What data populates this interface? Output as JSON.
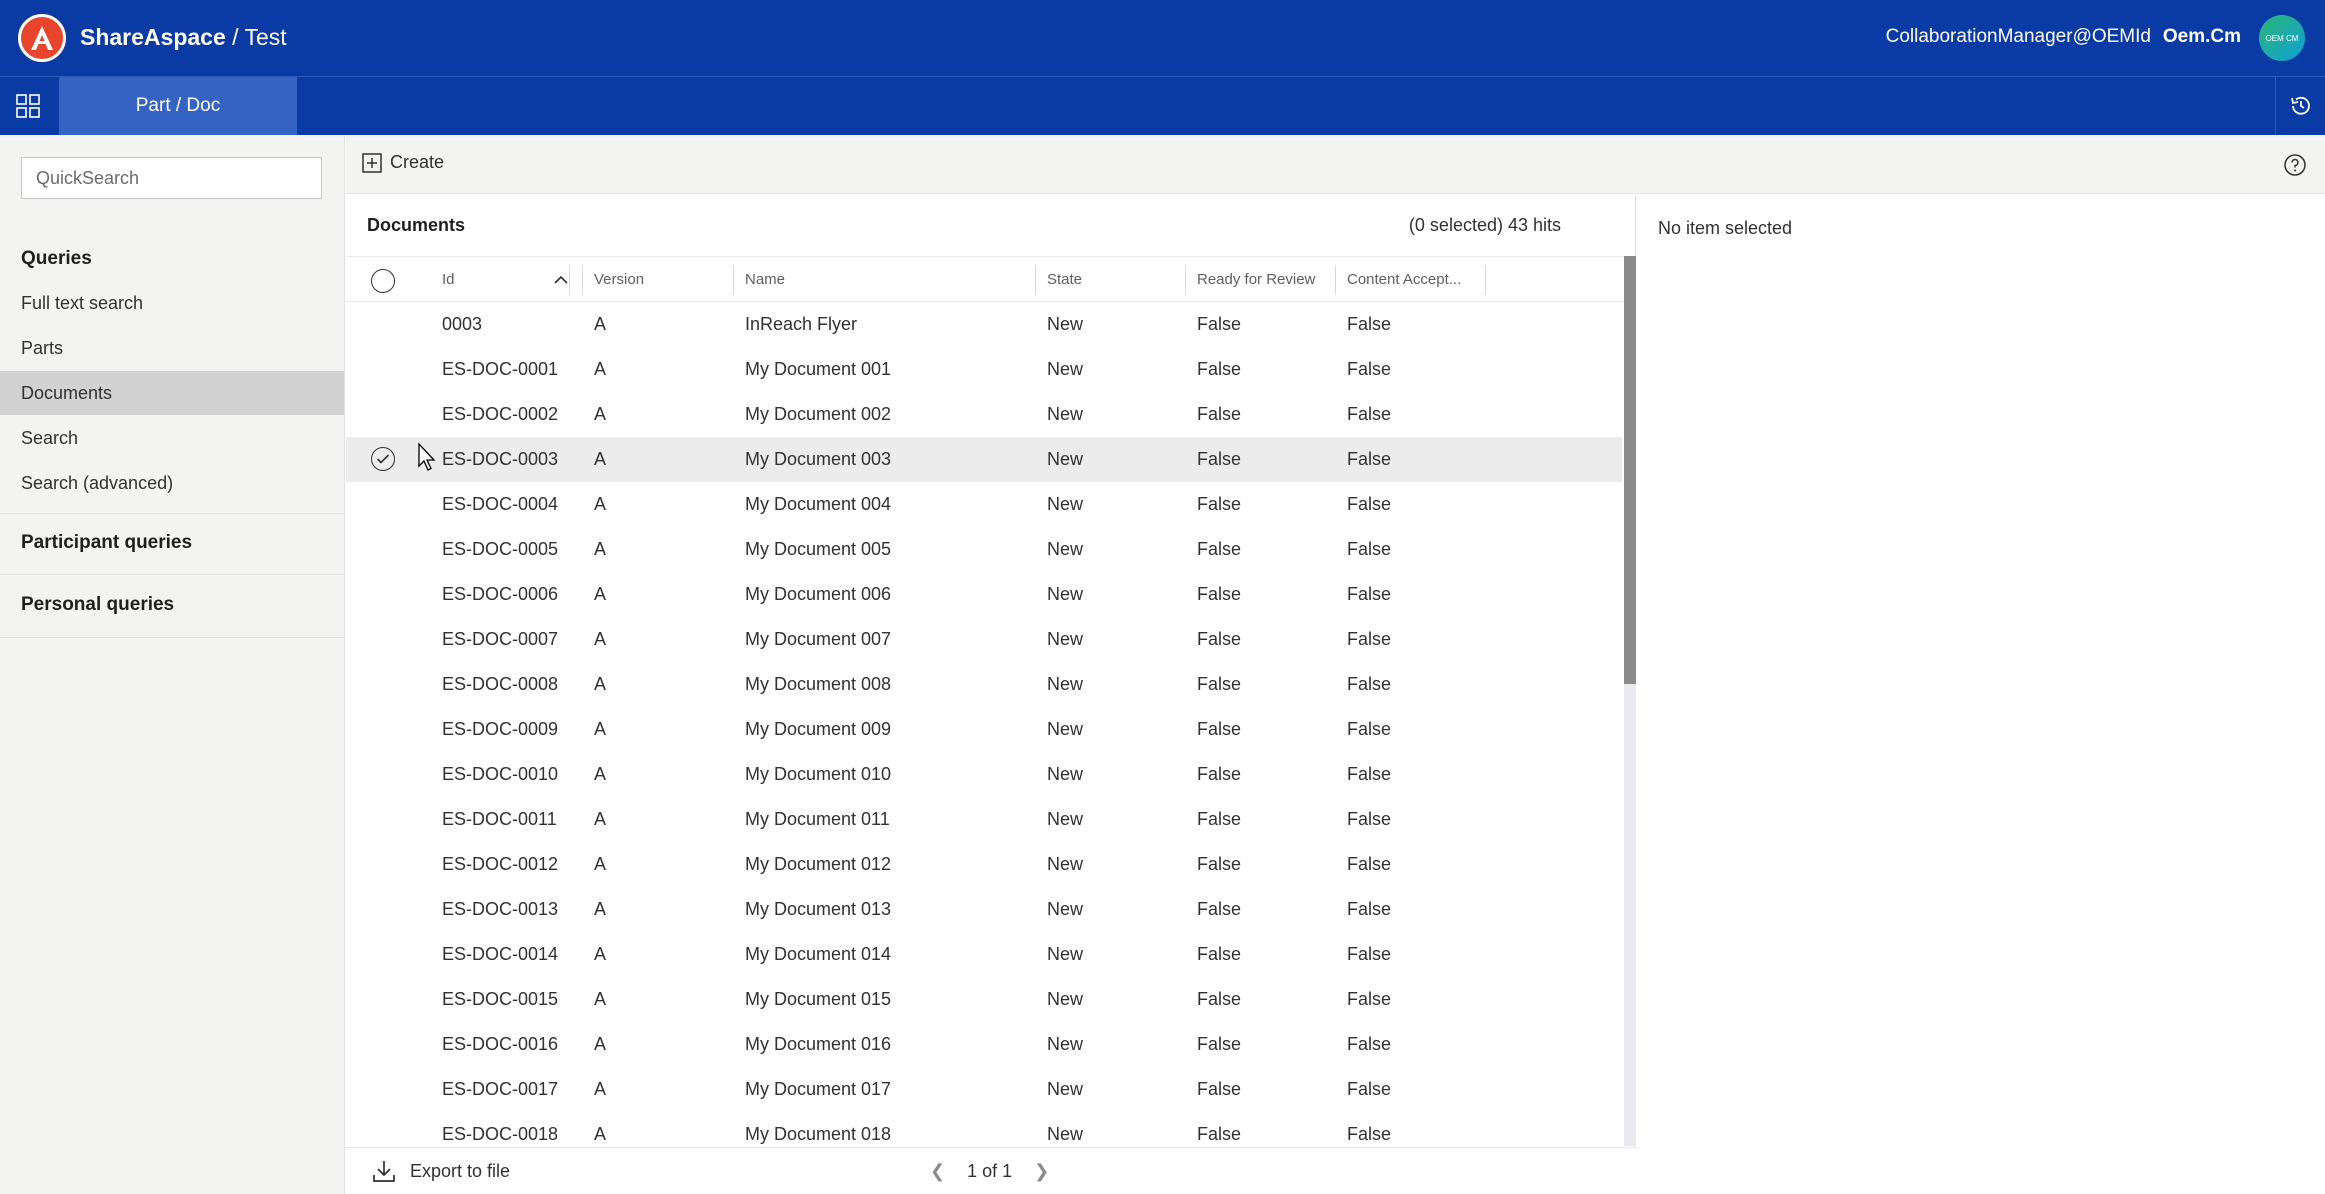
{
  "header": {
    "brand": "ShareAspace",
    "separator": " / ",
    "project": "Test",
    "user_email": "CollaborationManager@OEMId",
    "user_org": "Oem.Cm",
    "avatar_initials": "OEM CM"
  },
  "nav": {
    "apps_icon": "grid-icon",
    "active_tab": "Part / Doc",
    "history_icon": "history-icon"
  },
  "sidebar": {
    "quicksearch_placeholder": "QuickSearch",
    "queries_heading": "Queries",
    "items": [
      {
        "label": "Full text search"
      },
      {
        "label": "Parts"
      },
      {
        "label": "Documents"
      },
      {
        "label": "Search"
      },
      {
        "label": "Search (advanced)"
      }
    ],
    "active_item": "Documents",
    "participant_heading": "Participant queries",
    "personal_heading": "Personal queries"
  },
  "toolbar": {
    "create_label": "Create",
    "help_icon": "help-icon"
  },
  "documents": {
    "title": "Documents",
    "hits": "(0 selected) 43 hits",
    "columns": [
      "Id",
      "Version",
      "Name",
      "State",
      "Ready for Review",
      "Content Accept..."
    ],
    "sort_column": "Id",
    "sort_direction": "ascending",
    "rows": [
      {
        "id": "0003",
        "version": "A",
        "name": "InReach Flyer",
        "state": "New",
        "ready": "False",
        "content": "False"
      },
      {
        "id": "ES-DOC-0001",
        "version": "A",
        "name": "My Document 001",
        "state": "New",
        "ready": "False",
        "content": "False"
      },
      {
        "id": "ES-DOC-0002",
        "version": "A",
        "name": "My Document 002",
        "state": "New",
        "ready": "False",
        "content": "False"
      },
      {
        "id": "ES-DOC-0003",
        "version": "A",
        "name": "My Document 003",
        "state": "New",
        "ready": "False",
        "content": "False"
      },
      {
        "id": "ES-DOC-0004",
        "version": "A",
        "name": "My Document 004",
        "state": "New",
        "ready": "False",
        "content": "False"
      },
      {
        "id": "ES-DOC-0005",
        "version": "A",
        "name": "My Document 005",
        "state": "New",
        "ready": "False",
        "content": "False"
      },
      {
        "id": "ES-DOC-0006",
        "version": "A",
        "name": "My Document 006",
        "state": "New",
        "ready": "False",
        "content": "False"
      },
      {
        "id": "ES-DOC-0007",
        "version": "A",
        "name": "My Document 007",
        "state": "New",
        "ready": "False",
        "content": "False"
      },
      {
        "id": "ES-DOC-0008",
        "version": "A",
        "name": "My Document 008",
        "state": "New",
        "ready": "False",
        "content": "False"
      },
      {
        "id": "ES-DOC-0009",
        "version": "A",
        "name": "My Document 009",
        "state": "New",
        "ready": "False",
        "content": "False"
      },
      {
        "id": "ES-DOC-0010",
        "version": "A",
        "name": "My Document 010",
        "state": "New",
        "ready": "False",
        "content": "False"
      },
      {
        "id": "ES-DOC-0011",
        "version": "A",
        "name": "My Document 011",
        "state": "New",
        "ready": "False",
        "content": "False"
      },
      {
        "id": "ES-DOC-0012",
        "version": "A",
        "name": "My Document 012",
        "state": "New",
        "ready": "False",
        "content": "False"
      },
      {
        "id": "ES-DOC-0013",
        "version": "A",
        "name": "My Document 013",
        "state": "New",
        "ready": "False",
        "content": "False"
      },
      {
        "id": "ES-DOC-0014",
        "version": "A",
        "name": "My Document 014",
        "state": "New",
        "ready": "False",
        "content": "False"
      },
      {
        "id": "ES-DOC-0015",
        "version": "A",
        "name": "My Document 015",
        "state": "New",
        "ready": "False",
        "content": "False"
      },
      {
        "id": "ES-DOC-0016",
        "version": "A",
        "name": "My Document 016",
        "state": "New",
        "ready": "False",
        "content": "False"
      },
      {
        "id": "ES-DOC-0017",
        "version": "A",
        "name": "My Document 017",
        "state": "New",
        "ready": "False",
        "content": "False"
      },
      {
        "id": "ES-DOC-0018",
        "version": "A",
        "name": "My Document 018",
        "state": "New",
        "ready": "False",
        "content": "False"
      }
    ],
    "hovered_row": 3,
    "export_label": "Export to file",
    "pager": "1 of 1"
  },
  "details": {
    "empty_text": "No item selected"
  },
  "colors": {
    "header_bg": "#0a3aa3",
    "active_tab_bg": "#3563c4",
    "logo": "#e8452c",
    "sidebar_bg": "#f3f3f2",
    "active_item_bg": "#d2d2d2"
  }
}
